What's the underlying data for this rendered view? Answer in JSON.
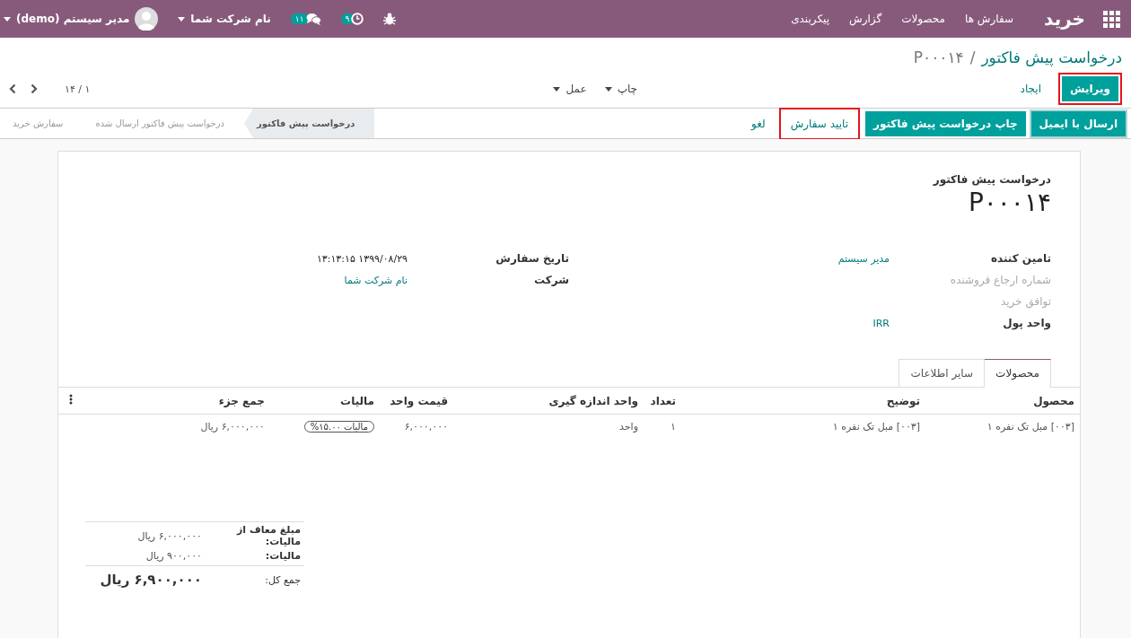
{
  "navbar": {
    "app_title": "خرید",
    "menu": [
      "سفارش ها",
      "محصولات",
      "گزارش",
      "پیکربندی"
    ],
    "activity_count": "۹",
    "message_count": "۱۱",
    "company": "نام شرکت شما",
    "user": "مدیر سیستم (demo)"
  },
  "breadcrumb": {
    "parent": "درخواست پیش فاکتور",
    "separator": "/",
    "current": "P۰۰۰۱۴"
  },
  "control_panel": {
    "buttons": [
      {
        "label": "ویرایش",
        "kind": "primary",
        "highlighted": true
      },
      {
        "label": "ایجاد",
        "kind": "link",
        "highlighted": false
      }
    ],
    "dropdowns": [
      "چاپ",
      "عمل"
    ],
    "pager": "۱ / ۱۴"
  },
  "status_bar": {
    "buttons": [
      {
        "label": "ارسال با ایمیل",
        "kind": "primary-outlined",
        "highlighted": false
      },
      {
        "label": "چاپ درخواست پیش فاکتور",
        "kind": "primary",
        "highlighted": false
      },
      {
        "label": "تایید سفارش",
        "kind": "link",
        "highlighted": true
      },
      {
        "label": "لغو",
        "kind": "link",
        "highlighted": false
      }
    ],
    "stages": [
      {
        "label": "درخواست پیش فاکتور",
        "selected": true
      },
      {
        "label": "درخواست پیش فاکتور ارسال شده",
        "selected": false
      },
      {
        "label": "سفارش خرید",
        "selected": false
      }
    ]
  },
  "sheet": {
    "subtitle": "درخواست پیش فاکتور",
    "name": "P۰۰۰۱۴",
    "groups": [
      [
        {
          "label": "تامین کننده",
          "value": "مدیر سیستم",
          "kind": "required",
          "link": true
        },
        {
          "label": "شماره ارجاع فروشنده",
          "kind": "optional"
        },
        {
          "label": "توافق خرید",
          "kind": "optional"
        },
        {
          "label": "واحد پول",
          "value": "IRR",
          "kind": "required",
          "link": true
        }
      ],
      [
        {
          "label": "تاریخ سفارش",
          "value": "۱۳۹۹/۰۸/۲۹ ۱۳:۱۳:۱۵",
          "kind": "required",
          "link": false
        },
        {
          "label": "شرکت",
          "value": "نام شرکت شما",
          "kind": "required",
          "link": true
        }
      ]
    ],
    "tabs": [
      {
        "label": "محصولات",
        "selected": true
      },
      {
        "label": "سایر اطلاعات",
        "selected": false
      }
    ],
    "table": {
      "columns": [
        "محصول",
        "توضیح",
        "تعداد",
        "واحد اندازه گیری",
        "قیمت واحد",
        "مالیات",
        "جمع جزء"
      ],
      "rows": [
        {
          "product": "[۰۰۳] مبل تک نفره ۱",
          "description": "[۰۰۳] مبل تک نفره ۱",
          "quantity": "۱",
          "uom": "واحد",
          "unit_price": "۶,۰۰۰,۰۰۰",
          "taxes": [
            "مالیات ۱۵.۰۰%"
          ],
          "subtotal": "۶,۰۰۰,۰۰۰ ریال"
        }
      ]
    },
    "totals": [
      {
        "label": "مبلغ معاف از مالیات:",
        "value": "۶,۰۰۰,۰۰۰ ریال",
        "kind": "line"
      },
      {
        "label": "مالیات:",
        "value": "۹۰۰,۰۰۰ ریال",
        "kind": "line"
      },
      {
        "label": "جمع کل:",
        "value": "۶,۹۰۰,۰۰۰ ریال",
        "kind": "grand"
      }
    ]
  }
}
